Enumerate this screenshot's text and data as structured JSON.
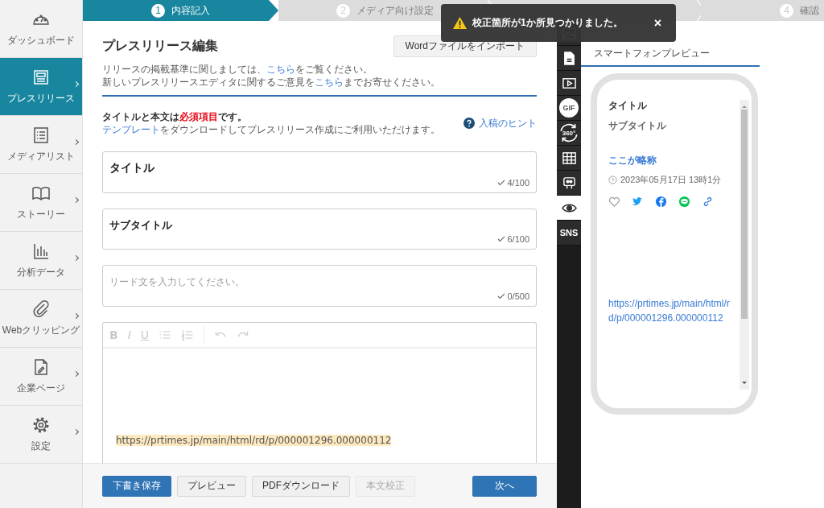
{
  "sidebar": {
    "items": [
      {
        "label": "ダッシュボード",
        "selected": false,
        "submenu": false
      },
      {
        "label": "プレスリリース",
        "selected": true,
        "submenu": true
      },
      {
        "label": "メディアリスト",
        "selected": false,
        "submenu": true
      },
      {
        "label": "ストーリー",
        "selected": false,
        "submenu": true
      },
      {
        "label": "分析データ",
        "selected": false,
        "submenu": true
      },
      {
        "label": "Webクリッピング",
        "selected": false,
        "submenu": true
      },
      {
        "label": "企業ページ",
        "selected": false,
        "submenu": true
      },
      {
        "label": "設定",
        "selected": false,
        "submenu": true
      }
    ]
  },
  "steps": [
    {
      "number": "1",
      "label": "内容記入",
      "selected": true
    },
    {
      "number": "2",
      "label": "メディア向け設定",
      "selected": false
    },
    {
      "selected": false
    },
    {
      "number": "4",
      "label": "確認",
      "selected": false
    }
  ],
  "toast": {
    "message": "校正箇所が1か所見つかりました。",
    "close": "×"
  },
  "editor": {
    "title": "プレスリリース編集",
    "import_button": "Wordファイルをインポート",
    "notice_lines": [
      [
        {
          "text": "リリースの掲載基準に関しましては、"
        },
        {
          "text": "こちら",
          "kind": "link"
        },
        {
          "text": "をご覧ください。"
        }
      ],
      [
        {
          "text": "新しいプレスリリースエディタに関するご意見を"
        },
        {
          "text": "こちら",
          "kind": "link"
        },
        {
          "text": "までお寄せください。"
        }
      ]
    ],
    "required_line": [
      {
        "text": "タイトルと本文は"
      },
      {
        "text": "必須項目",
        "kind": "emphasis"
      },
      {
        "text": "です。"
      }
    ],
    "template_line": [
      {
        "text": "テンプレート",
        "kind": "link"
      },
      {
        "text": "をダウンロードしてプレスリリース作成にご利用いただけます。"
      }
    ],
    "hint_link": "入稿のヒント",
    "fields": [
      {
        "kind": "title",
        "value": "タイトル",
        "counter": "4/100"
      },
      {
        "kind": "subtitle",
        "value": "サブタイトル",
        "counter": "6/100"
      },
      {
        "kind": "lead",
        "placeholder": "リード文を入力してください。",
        "counter": "0/500"
      }
    ],
    "body_editor": {
      "toolbar": [
        {
          "kind": "bold",
          "label": "B",
          "disabled": true
        },
        {
          "kind": "italic",
          "label": "I",
          "disabled": true
        },
        {
          "kind": "underline",
          "label": "U",
          "disabled": true
        },
        {
          "kind": "bullet-list",
          "disabled": true
        },
        {
          "kind": "numbered-list",
          "disabled": true
        },
        {
          "kind": "separator"
        },
        {
          "kind": "undo",
          "disabled": true
        },
        {
          "kind": "redo",
          "disabled": true
        }
      ],
      "content_link": "https://prtimes.jp/main/html/rd/p/000001296.000000112"
    }
  },
  "footer": {
    "buttons": [
      {
        "label": "下書き保存",
        "kind": "primary",
        "disabled": false
      },
      {
        "label": "プレビュー",
        "kind": "default",
        "disabled": false
      },
      {
        "label": "PDFダウンロード",
        "kind": "default",
        "disabled": false
      },
      {
        "label": "本文校正",
        "kind": "default",
        "disabled": true
      }
    ],
    "next_button": {
      "label": "次へ",
      "kind": "primary",
      "disabled": false
    }
  },
  "tool_rail": {
    "items": [
      {
        "kind": "image",
        "selected": false
      },
      {
        "kind": "document",
        "selected": false
      },
      {
        "kind": "video",
        "selected": false
      },
      {
        "kind": "gif",
        "label": "GIF",
        "selected": false
      },
      {
        "kind": "panorama",
        "label": "360°",
        "selected": false
      },
      {
        "kind": "table",
        "selected": false
      },
      {
        "kind": "embed",
        "selected": false
      },
      {
        "kind": "preview",
        "selected": true
      },
      {
        "kind": "sns",
        "label": "SNS",
        "selected": false
      }
    ]
  },
  "preview": {
    "heading": "スマートフォンプレビュー",
    "title": "タイトル",
    "subtitle": "サブタイトル",
    "company": "ここが略称",
    "date": "2023年05月17日 13時1分",
    "url": "https://prtimes.jp/main/html/rd/p/000001296.000000112"
  }
}
